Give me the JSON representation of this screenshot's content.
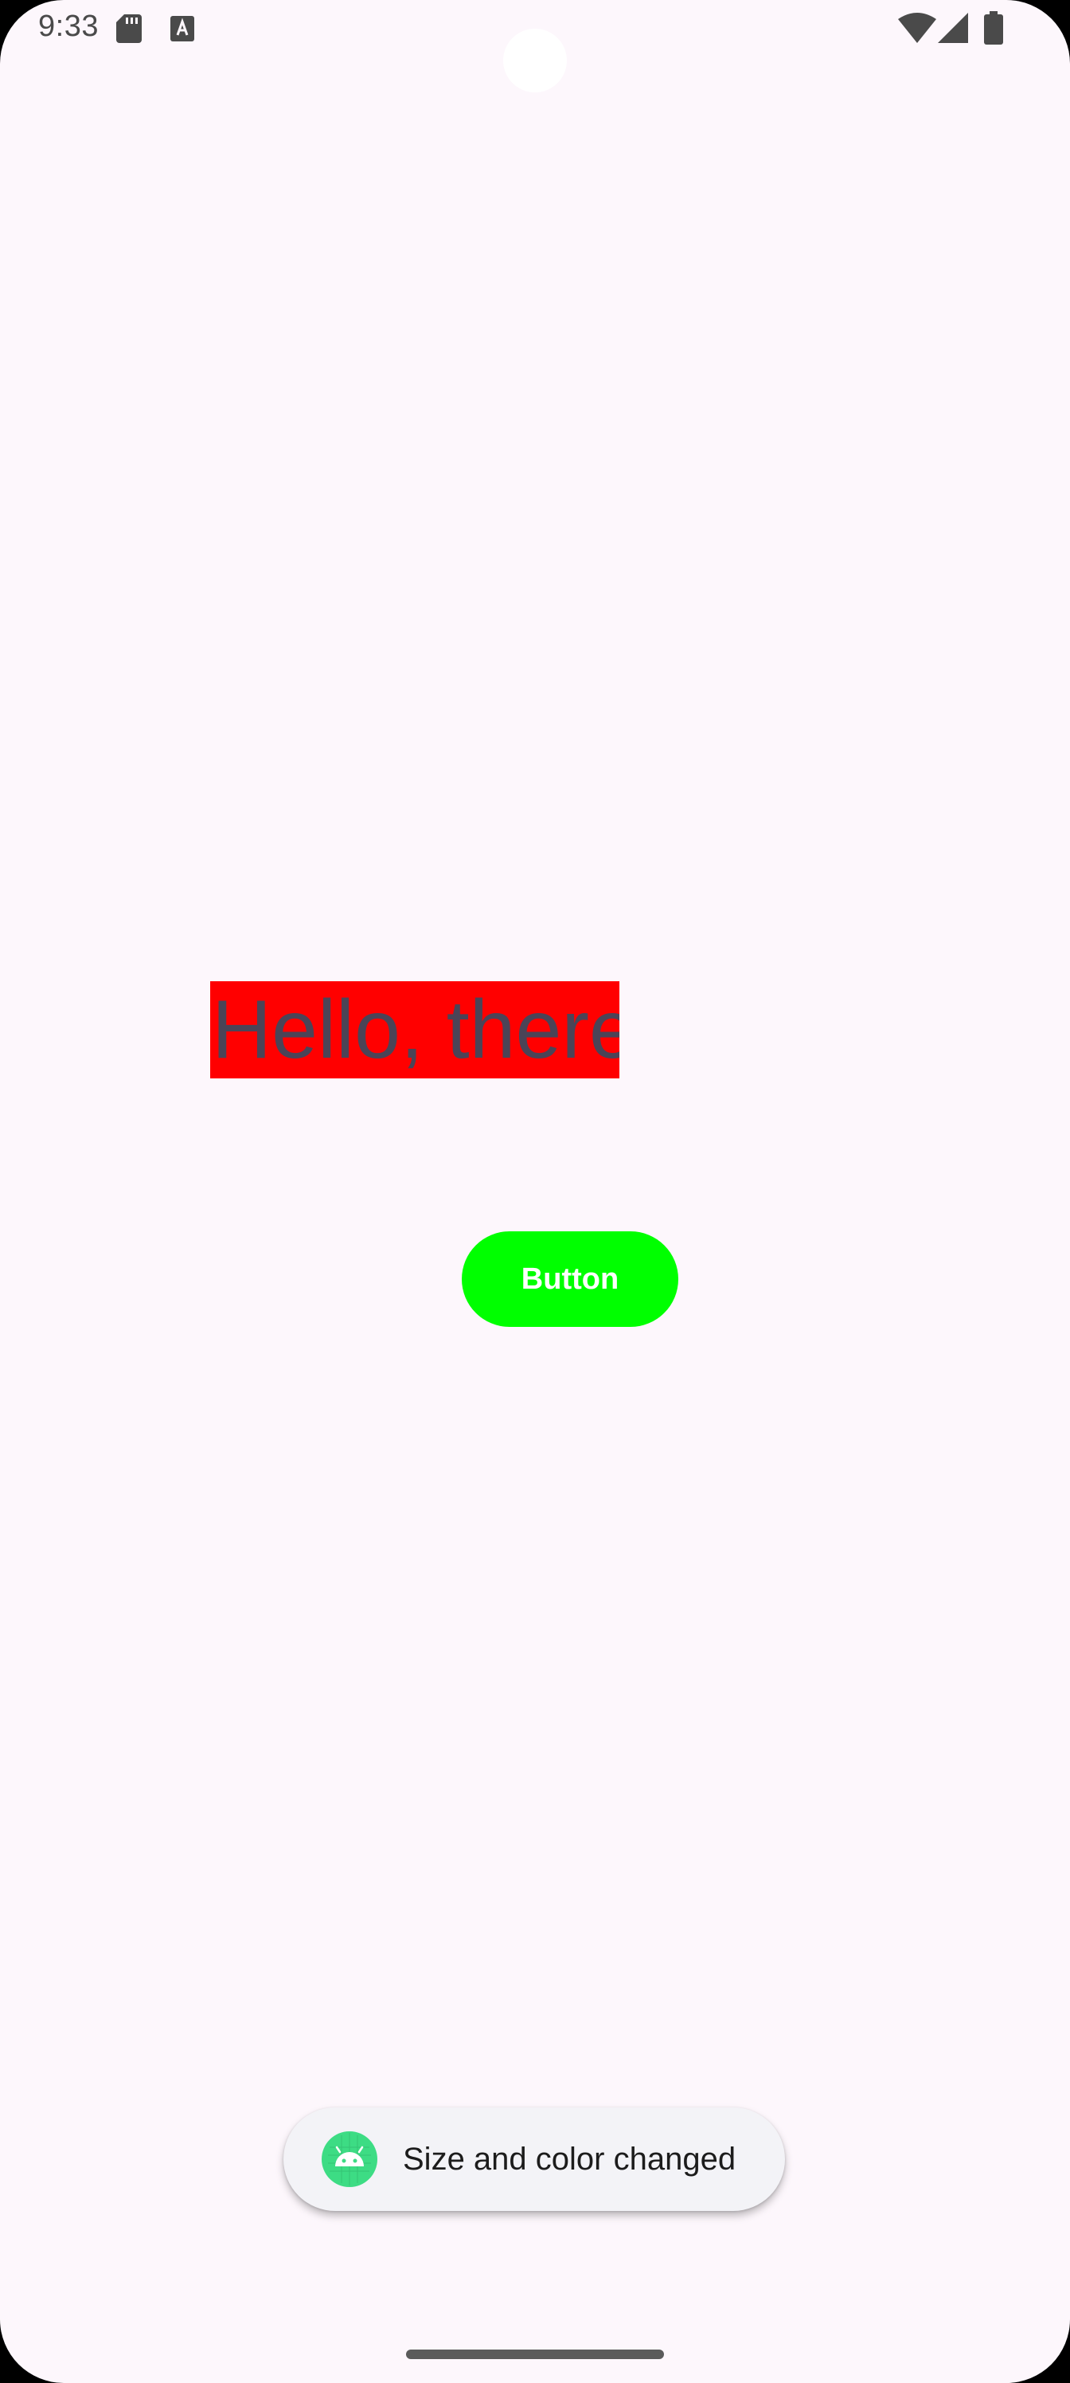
{
  "status_bar": {
    "time": "9:33",
    "icons": [
      "sd-card-icon",
      "font-a-icon",
      "wifi-icon",
      "cell-signal-icon",
      "battery-icon"
    ]
  },
  "main": {
    "hello_text": "Hello, there",
    "hello_background": "#FF0000",
    "hello_color": "#4B4457",
    "button_label": "Button",
    "button_color": "#00FF00"
  },
  "toast": {
    "message": "Size and color changed",
    "icon": "android-icon"
  },
  "colors": {
    "screen_background": "#FDF7FC"
  }
}
